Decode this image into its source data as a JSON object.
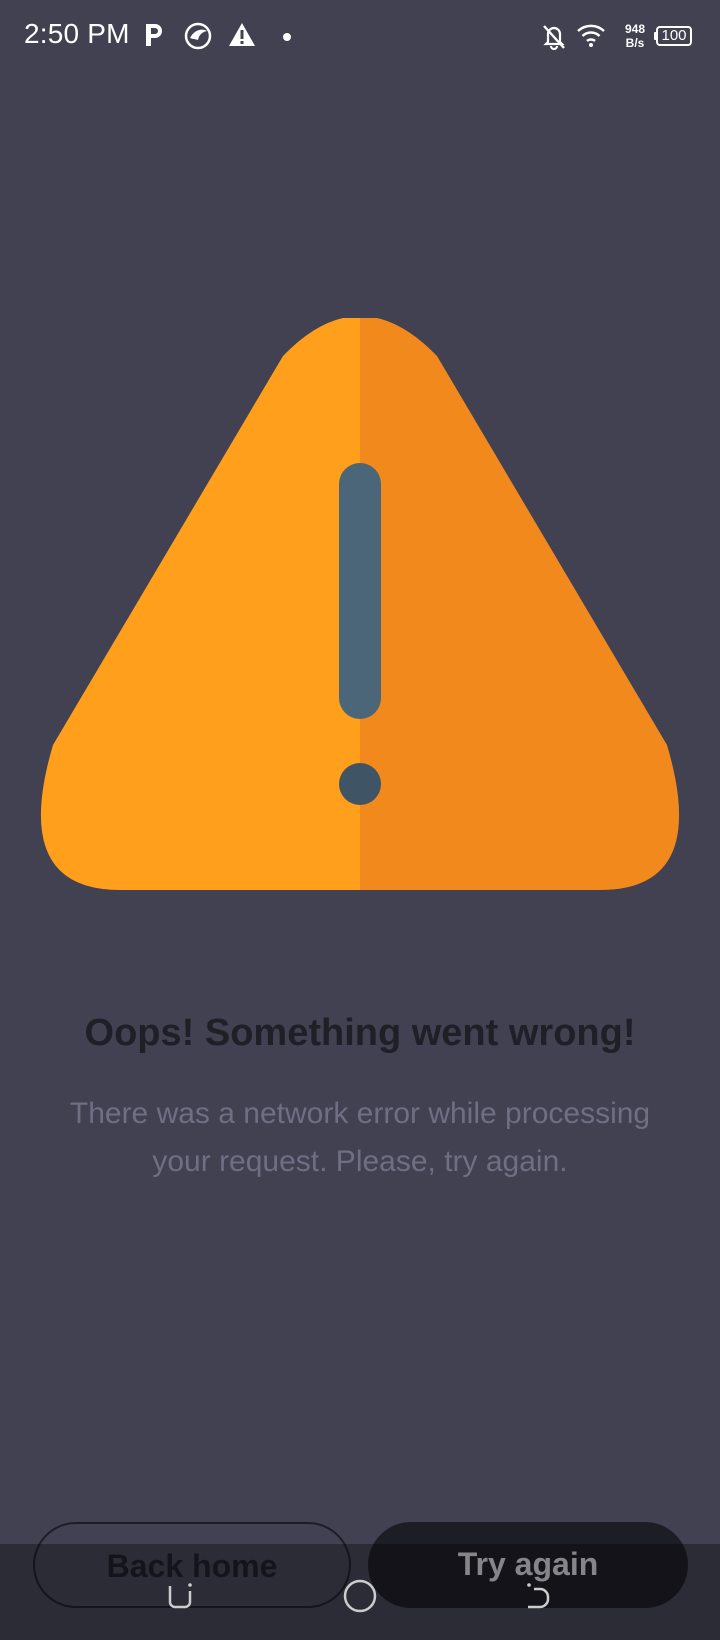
{
  "status_bar": {
    "time": "2:50 PM",
    "net_speed_value": "948",
    "net_speed_unit": "B/s",
    "battery_level": "100",
    "icons": [
      "parking-app-icon",
      "bird-app-icon",
      "alert-notification-icon",
      "notification-dot-icon",
      "bell-off-icon",
      "wifi-icon",
      "battery-icon"
    ]
  },
  "illustration": {
    "icon": "warning-triangle-icon",
    "colors": {
      "left_half": "#FF9F1C",
      "right_half": "#F1891D",
      "exclamation": "#4B6678",
      "dot": "#3F5565"
    }
  },
  "error": {
    "title": "Oops! Something went wrong!",
    "message": "There was a network error while processing your request. Please, try again."
  },
  "actions": {
    "back_home_label": "Back home",
    "try_again_label": "Try again"
  },
  "nav_bar": {
    "icons": [
      "recents-icon",
      "home-icon",
      "back-icon"
    ]
  },
  "colors": {
    "background": "#414151",
    "title_text": "#1F1F28",
    "message_text": "#6E6E84"
  }
}
